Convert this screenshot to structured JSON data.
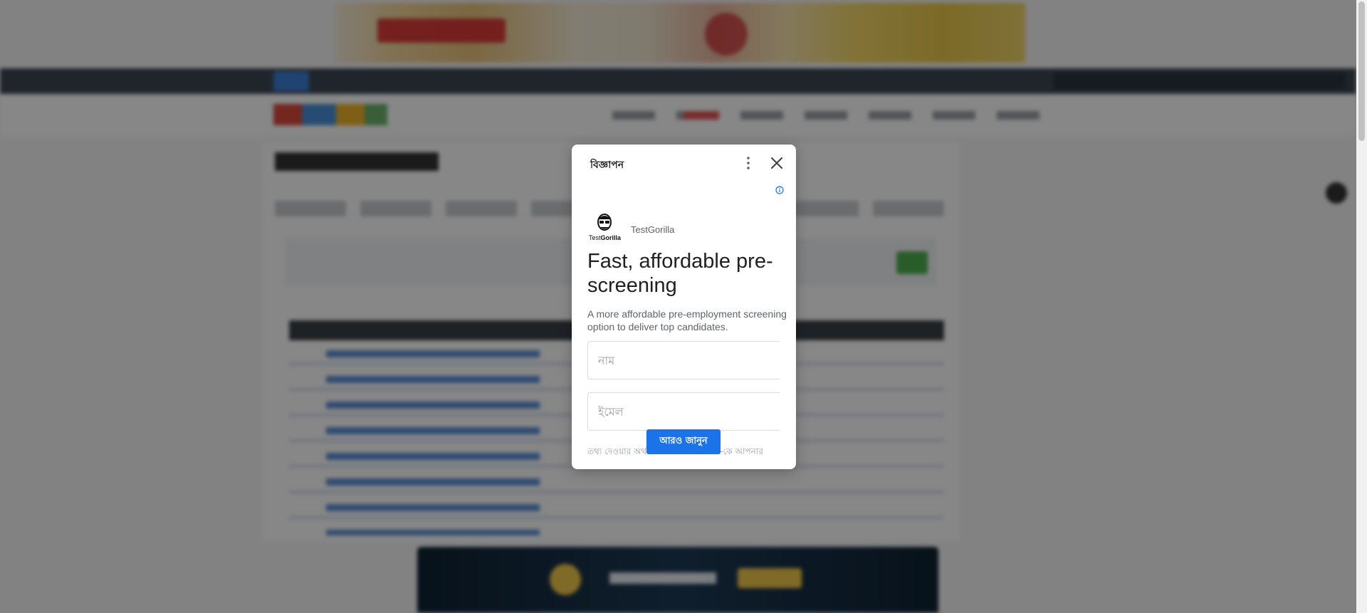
{
  "ad_modal": {
    "ad_label": "বিজ্ঞাপন",
    "advertiser": {
      "name": "TestGorilla",
      "logo_text_prefix": "Test",
      "logo_text_bold": "Gorilla"
    },
    "headline": "Fast, affordable pre-screening",
    "description": "A more affordable pre-employment screening option to deliver top candidates.",
    "name_placeholder": "নাম",
    "email_placeholder": "ইমেল",
    "cta_label": "আরও জানুন",
    "disclaimer": "তথ্য দেওয়ার অর্থ আপনি TestGorilla-কে আপনার"
  },
  "colors": {
    "cta": "#1a73e8",
    "overlay": "rgba(0,0,0,0.47)",
    "info_icon": "#1a73e8"
  },
  "icons": [
    "more-vert-icon",
    "close-icon",
    "info-icon",
    "testgorilla-logo"
  ]
}
